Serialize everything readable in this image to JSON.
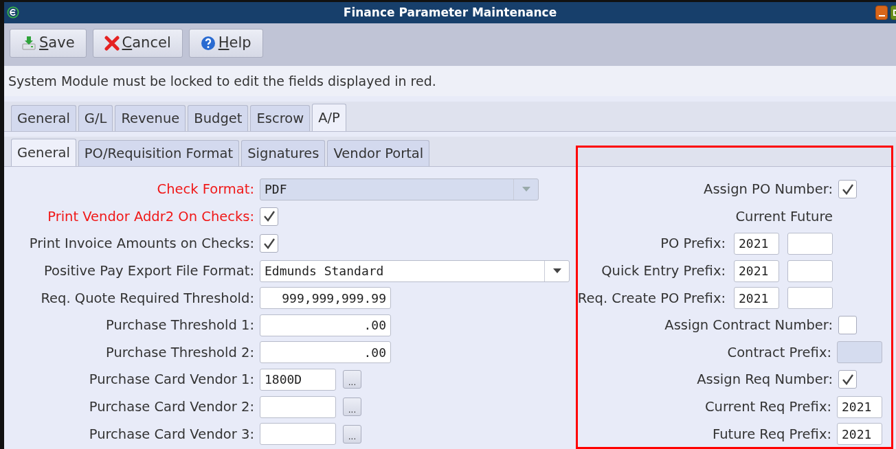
{
  "window": {
    "title": "Finance Parameter Maintenance"
  },
  "toolbar": [
    {
      "label": "Save",
      "underline_first": true
    },
    {
      "label": "Cancel",
      "underline_first": true
    },
    {
      "label": "Help",
      "underline_first": true
    }
  ],
  "message": "System Module must be locked to edit the fields displayed in red.",
  "tabs": [
    {
      "label": "General",
      "selected": false
    },
    {
      "label": "G/L",
      "selected": false
    },
    {
      "label": "Revenue",
      "selected": false
    },
    {
      "label": "Budget",
      "selected": false
    },
    {
      "label": "Escrow",
      "selected": false
    },
    {
      "label": "A/P",
      "selected": true
    }
  ],
  "subtabs": [
    {
      "label": "General",
      "selected": true
    },
    {
      "label": "PO/Requisition Format",
      "selected": false
    },
    {
      "label": "Signatures",
      "selected": false
    },
    {
      "label": "Vendor Portal",
      "selected": false
    }
  ],
  "left_fields": [
    {
      "kind": "select",
      "label": "Check Format:",
      "value": "PDF",
      "red": true,
      "disabled": true
    },
    {
      "kind": "checkbox",
      "label": "Print Vendor Addr2 On Checks:",
      "checked": true,
      "red": true
    },
    {
      "kind": "checkbox",
      "label": "Print Invoice Amounts on Checks:",
      "checked": true,
      "red": false
    },
    {
      "kind": "select",
      "label": "Positive Pay Export File Format:",
      "value": "Edmunds Standard",
      "red": false,
      "disabled": false
    },
    {
      "kind": "number",
      "label": "Req. Quote Required Threshold:",
      "value": "999,999,999.99",
      "red": false
    },
    {
      "kind": "number",
      "label": "Purchase Threshold 1:",
      "value": ".00",
      "red": false
    },
    {
      "kind": "number",
      "label": "Purchase Threshold 2:",
      "value": ".00",
      "red": false
    },
    {
      "kind": "lookup",
      "label": "Purchase Card Vendor 1:",
      "value": "1800D",
      "button": "...",
      "red": false
    },
    {
      "kind": "lookup",
      "label": "Purchase Card Vendor 2:",
      "button": "...",
      "red": false
    },
    {
      "kind": "lookup",
      "label": "Purchase Card Vendor 3:",
      "button": "...",
      "red": false
    }
  ],
  "right_fields": [
    {
      "kind": "checkbox",
      "label": "Assign PO Number:",
      "checked": true
    },
    {
      "kind": "header",
      "label": "Current Future"
    },
    {
      "kind": "pair",
      "label": "PO Prefix:",
      "current": "2021"
    },
    {
      "kind": "pair",
      "label": "Quick Entry Prefix:",
      "current": "2021"
    },
    {
      "kind": "pair",
      "label": "Req. Create PO Prefix:",
      "current": "2021"
    },
    {
      "kind": "checkbox",
      "label": "Assign Contract Number:",
      "checked": false
    },
    {
      "kind": "field",
      "label": "Contract Prefix:",
      "disabled": true
    },
    {
      "kind": "checkbox",
      "label": "Assign Req Number:",
      "checked": true
    },
    {
      "kind": "field",
      "label": "Current Req Prefix:",
      "value": "2021",
      "disabled": false
    },
    {
      "kind": "field",
      "label": "Future Req Prefix:",
      "value": "2021",
      "disabled": false
    }
  ],
  "highlight": {
    "color": "#ff0000"
  }
}
